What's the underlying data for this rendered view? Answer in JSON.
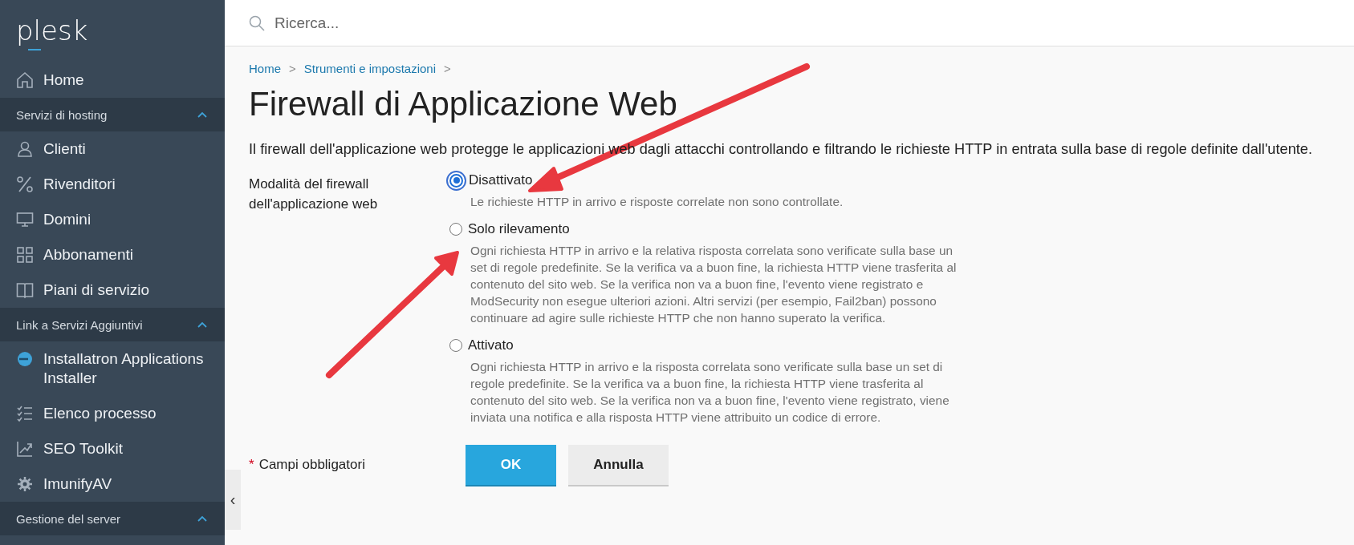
{
  "sidebar": {
    "logo": "plesk",
    "items": [
      {
        "kind": "item",
        "label": "Home"
      },
      {
        "kind": "section",
        "label": "Servizi di hosting",
        "expanded": true
      },
      {
        "kind": "item",
        "label": "Clienti"
      },
      {
        "kind": "item",
        "label": "Rivenditori"
      },
      {
        "kind": "item",
        "label": "Domini"
      },
      {
        "kind": "item",
        "label": "Abbonamenti"
      },
      {
        "kind": "item",
        "label": "Piani di servizio"
      },
      {
        "kind": "section",
        "label": "Link a Servizi Aggiuntivi",
        "expanded": true
      },
      {
        "kind": "item",
        "label": "Installatron Applications Installer"
      },
      {
        "kind": "item",
        "label": "Elenco processo"
      },
      {
        "kind": "item",
        "label": "SEO Toolkit"
      },
      {
        "kind": "item",
        "label": "ImunifyAV"
      },
      {
        "kind": "section",
        "label": "Gestione del server",
        "expanded": true
      }
    ],
    "collapse": "‹"
  },
  "search": {
    "placeholder": "Ricerca..."
  },
  "breadcrumb": [
    {
      "label": "Home",
      "separator": ">"
    },
    {
      "label": "Strumenti e impostazioni",
      "separator": ">"
    }
  ],
  "title": "Firewall di Applicazione Web",
  "description": "Il firewall dell'applicazione web protegge le applicazioni web dagli attacchi controllando e filtrando le richieste HTTP in entrata sulla base di regole definite dall'utente.",
  "form": {
    "label": "Modalità del firewall dell'applicazione web",
    "options": [
      {
        "label": "Disattivato",
        "selected": true,
        "hint": "Le richieste HTTP in arrivo e risposte correlate non sono controllate."
      },
      {
        "label": "Solo rilevamento",
        "selected": false,
        "hint": "Ogni richiesta HTTP in arrivo e la relativa risposta correlata sono verificate sulla base un set di regole predefinite. Se la verifica va a buon fine, la richiesta HTTP viene trasferita al contenuto del sito web. Se la verifica non va a buon fine, l'evento viene registrato e ModSecurity non esegue ulteriori azioni. Altri servizi (per esempio, Fail2ban) possono continuare ad agire sulle richieste HTTP che non hanno superato la verifica."
      },
      {
        "label": "Attivato",
        "selected": false,
        "hint": "Ogni richiesta HTTP in arrivo e la risposta correlata sono verificate sulla base un set di regole predefinite. Se la verifica va a buon fine, la richiesta HTTP viene trasferita al contenuto del sito web. Se la verifica non va a buon fine, l'evento viene registrato, viene inviata una notifica e alla risposta HTTP viene attribuito un codice di errore."
      }
    ],
    "required_mark": "*",
    "required_note": "Campi obbligatori",
    "buttons": [
      {
        "label": "OK",
        "kind": "primary"
      },
      {
        "label": "Annulla",
        "kind": "secondary"
      }
    ]
  }
}
